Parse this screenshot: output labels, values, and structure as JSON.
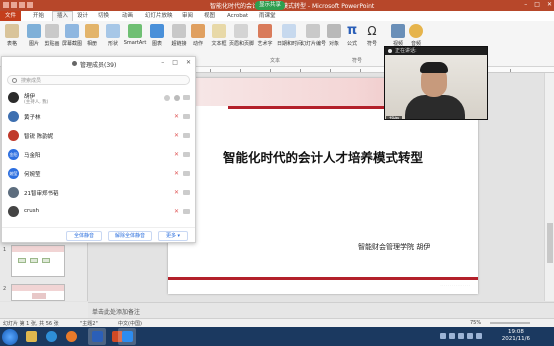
{
  "window": {
    "title": "智能化时代的会计人才培养模式转型 - Microsoft PowerPoint",
    "share_badge": "显示共享",
    "controls": [
      "–",
      "□",
      "✕"
    ]
  },
  "tabs": [
    "文件",
    "开始",
    "插入",
    "设计",
    "切换",
    "动画",
    "幻灯片放映",
    "审阅",
    "视图",
    "Acrobat",
    "雨课堂"
  ],
  "ribbon": {
    "buttons": [
      "表格",
      "图片",
      "剪贴画",
      "屏幕截图",
      "相册",
      "形状",
      "SmartArt",
      "图表",
      "超链接",
      "动作",
      "文本框",
      "页眉和页脚",
      "艺术字",
      "日期和时间",
      "幻灯片编号",
      "对象",
      "公式",
      "符号",
      "视频",
      "音频"
    ],
    "groups": [
      "文本",
      "符号"
    ]
  },
  "participants_panel": {
    "title": "管理成员(39)",
    "search_placeholder": "搜索成员",
    "members": [
      {
        "name": "胡伊",
        "role": "(主持人, 我)",
        "avatar": "",
        "avatar_color": "#2b2b2b"
      },
      {
        "name": "黄子林",
        "role": "",
        "avatar": "",
        "avatar_color": "#3d6fb0"
      },
      {
        "name": "智锐 陈韵妮",
        "role": "",
        "avatar": "",
        "avatar_color": "#c0392b"
      },
      {
        "name": "马金阳",
        "role": "",
        "avatar": "金阳",
        "avatar_color": "#2d6fe0"
      },
      {
        "name": "何婉莹",
        "role": "",
        "avatar": "婉莹",
        "avatar_color": "#2d6fe0"
      },
      {
        "name": "21智审郑书韬",
        "role": "",
        "avatar": "",
        "avatar_color": "#5d6d7e"
      },
      {
        "name": "crush",
        "role": "",
        "avatar": "",
        "avatar_color": "#444444"
      }
    ],
    "buttons": [
      "全体静音",
      "解除全体静音",
      "更多 ▾"
    ]
  },
  "video": {
    "header": "正在讲话:",
    "name_tag": "胡伊"
  },
  "slide": {
    "title": "智能化时代的会计人才培养模式转型",
    "subtitle": "智能财会管理学院 胡伊"
  },
  "thumbnails": [
    {
      "num": "1"
    },
    {
      "num": "2"
    }
  ],
  "notes": {
    "placeholder": "单击此处添加备注"
  },
  "status": {
    "slide_info": "幻灯片 第 1 张, 共 56 张",
    "theme": "\"主题2\"",
    "language": "中文(中国)",
    "zoom": "75%"
  },
  "taskbar": {
    "time": "19:08",
    "date": "2021/11/6"
  },
  "colors": {
    "ppt_red": "#b7472a",
    "slide_accent": "#b3202a",
    "taskbar": "#1b3960",
    "link_blue": "#2b6fde"
  }
}
